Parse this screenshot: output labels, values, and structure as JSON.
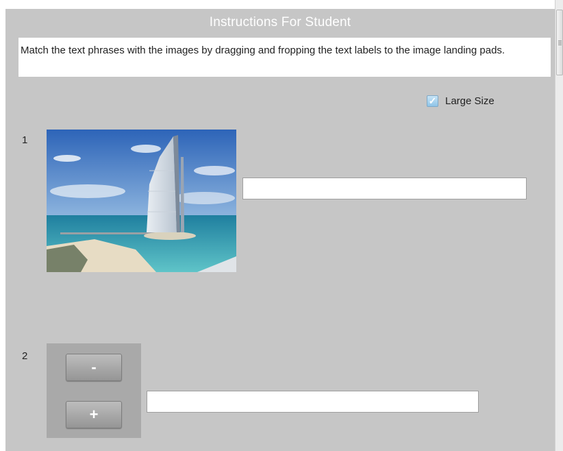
{
  "title": "Instructions For Student",
  "instructions": "Match the text phrases with the images by dragging and fropping the text labels to the image landing pads.",
  "large_size": {
    "label": "Large Size",
    "checked": true,
    "checkmark": "✓"
  },
  "items": [
    {
      "number": "1",
      "pad_value": ""
    },
    {
      "number": "2",
      "pad_value": ""
    }
  ],
  "zoom": {
    "minus": "-",
    "plus": "+"
  },
  "colors": {
    "panel": "#c6c6c6",
    "sky": "#3d74c2",
    "sea": "#2f9fb0",
    "checkbox": "#8ec4e8"
  },
  "icons": {
    "checkbox": "checkbox-checked-icon",
    "scroll": "scroll-grip-icon"
  }
}
